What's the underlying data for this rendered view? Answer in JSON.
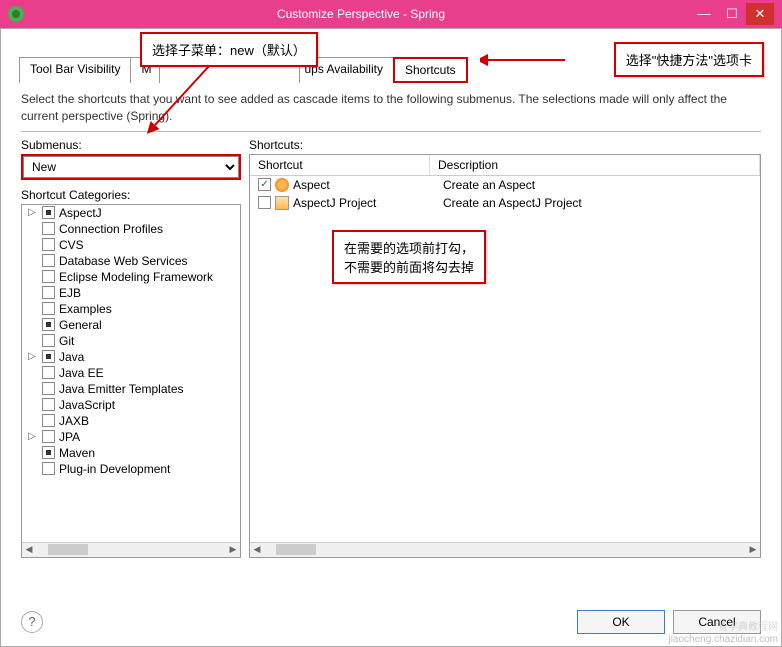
{
  "titlebar": {
    "title": "Customize Perspective - Spring",
    "min": "—",
    "max": "☐",
    "close": "✕"
  },
  "tabs": {
    "visibility": "Tool Bar Visibility",
    "menu": "Menu Visibility",
    "availability": "Command Groups Availability",
    "shortcuts": "Shortcuts"
  },
  "description": "Select the shortcuts that you want to see added as cascade items to the following submenus.  The selections made will only affect the current perspective (Spring).",
  "submenus": {
    "label": "Submenus:",
    "value": "New"
  },
  "categories": {
    "label": "Shortcut Categories:",
    "items": [
      {
        "arrow": "▷",
        "checked": "dot",
        "label": "AspectJ"
      },
      {
        "arrow": "",
        "checked": "",
        "label": "Connection Profiles"
      },
      {
        "arrow": "",
        "checked": "",
        "label": "CVS"
      },
      {
        "arrow": "",
        "checked": "",
        "label": "Database Web Services"
      },
      {
        "arrow": "",
        "checked": "",
        "label": "Eclipse Modeling Framework"
      },
      {
        "arrow": "",
        "checked": "",
        "label": "EJB"
      },
      {
        "arrow": "",
        "checked": "",
        "label": "Examples"
      },
      {
        "arrow": "",
        "checked": "dot",
        "label": "General"
      },
      {
        "arrow": "",
        "checked": "",
        "label": "Git"
      },
      {
        "arrow": "▷",
        "checked": "dot",
        "label": "Java"
      },
      {
        "arrow": "",
        "checked": "",
        "label": "Java EE"
      },
      {
        "arrow": "",
        "checked": "",
        "label": "Java Emitter Templates"
      },
      {
        "arrow": "",
        "checked": "",
        "label": "JavaScript"
      },
      {
        "arrow": "",
        "checked": "",
        "label": "JAXB"
      },
      {
        "arrow": "▷",
        "checked": "",
        "label": "JPA"
      },
      {
        "arrow": "",
        "checked": "dot",
        "label": "Maven"
      },
      {
        "arrow": "",
        "checked": "",
        "label": "Plug-in Development"
      }
    ]
  },
  "shortcuts": {
    "label": "Shortcuts:",
    "header_shortcut": "Shortcut",
    "header_desc": "Description",
    "rows": [
      {
        "checked": true,
        "icon": "aspect",
        "name": "Aspect",
        "desc": "Create an Aspect"
      },
      {
        "checked": false,
        "icon": "aspectj",
        "name": "AspectJ Project",
        "desc": "Create an AspectJ Project"
      }
    ]
  },
  "callouts": {
    "top_left": "选择子菜单：new（默认）",
    "top_right": "选择\"快捷方法\"选项卡",
    "center_line1": "在需要的选项前打勾，",
    "center_line2": "不需要的前面将勾去掉"
  },
  "footer": {
    "ok": "OK",
    "cancel": "Cancel"
  },
  "watermark1": "查字典教程网",
  "watermark2": "jiaocheng.chazidian.com"
}
